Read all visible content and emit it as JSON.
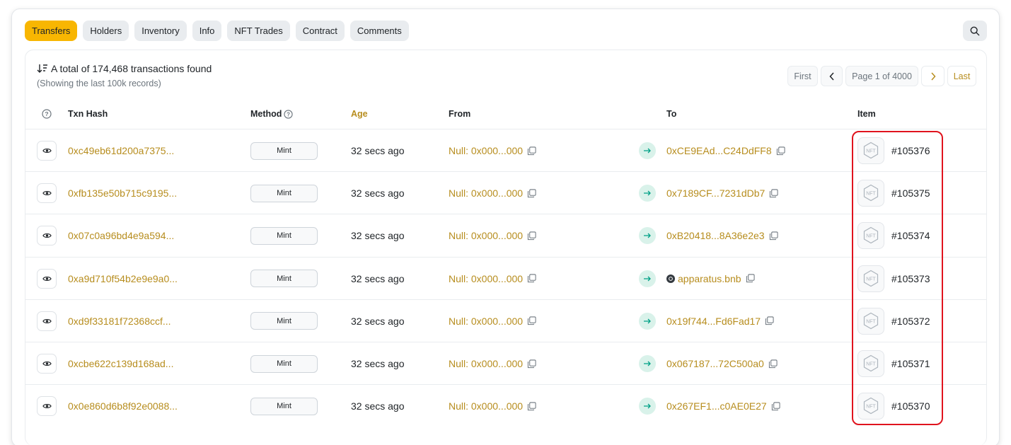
{
  "tabs": [
    {
      "label": "Transfers",
      "active": true
    },
    {
      "label": "Holders"
    },
    {
      "label": "Inventory"
    },
    {
      "label": "Info"
    },
    {
      "label": "NFT Trades"
    },
    {
      "label": "Contract"
    },
    {
      "label": "Comments"
    }
  ],
  "summary": {
    "text": "A total of 174,468 transactions found",
    "sub": "(Showing the last 100k records)"
  },
  "pager": {
    "first": "First",
    "page_label": "Page 1 of 4000",
    "last": "Last"
  },
  "table": {
    "headers": {
      "txn_hash": "Txn Hash",
      "method": "Method",
      "age": "Age",
      "from": "From",
      "to": "To",
      "item": "Item"
    },
    "rows": [
      {
        "hash": "0xc49eb61d200a7375...",
        "method": "Mint",
        "age": "32 secs ago",
        "from": "Null: 0x000...000",
        "to": "0xCE9EAd...C24DdFF8",
        "item": "#105376"
      },
      {
        "hash": "0xfb135e50b715c9195...",
        "method": "Mint",
        "age": "32 secs ago",
        "from": "Null: 0x000...000",
        "to": "0x7189CF...7231dDb7",
        "item": "#105375"
      },
      {
        "hash": "0x07c0a96bd4e9a594...",
        "method": "Mint",
        "age": "32 secs ago",
        "from": "Null: 0x000...000",
        "to": "0xB20418...8A36e2e3",
        "item": "#105374"
      },
      {
        "hash": "0xa9d710f54b2e9e9a0...",
        "method": "Mint",
        "age": "32 secs ago",
        "from": "Null: 0x000...000",
        "to": "apparatus.bnb",
        "to_is_name": true,
        "item": "#105373"
      },
      {
        "hash": "0xd9f33181f72368ccf...",
        "method": "Mint",
        "age": "32 secs ago",
        "from": "Null: 0x000...000",
        "to": "0x19f744...Fd6Fad17",
        "item": "#105372"
      },
      {
        "hash": "0xcbe622c139d168ad...",
        "method": "Mint",
        "age": "32 secs ago",
        "from": "Null: 0x000...000",
        "to": "0x067187...72C500a0",
        "item": "#105371"
      },
      {
        "hash": "0x0e860d6b8f92e0088...",
        "method": "Mint",
        "age": "32 secs ago",
        "from": "Null: 0x000...000",
        "to": "0x267EF1...c0AE0E27",
        "item": "#105370"
      }
    ]
  },
  "icons": {
    "search": "search-icon",
    "sort": "sort-icon",
    "eye": "eye-icon",
    "copy": "copy-icon",
    "arrow": "arrow-right-icon",
    "nft": "nft-placeholder-icon",
    "help": "question-circle-icon"
  },
  "colors": {
    "accent": "#f8b602",
    "link": "#b78d1e",
    "highlight": "#e0141e"
  }
}
